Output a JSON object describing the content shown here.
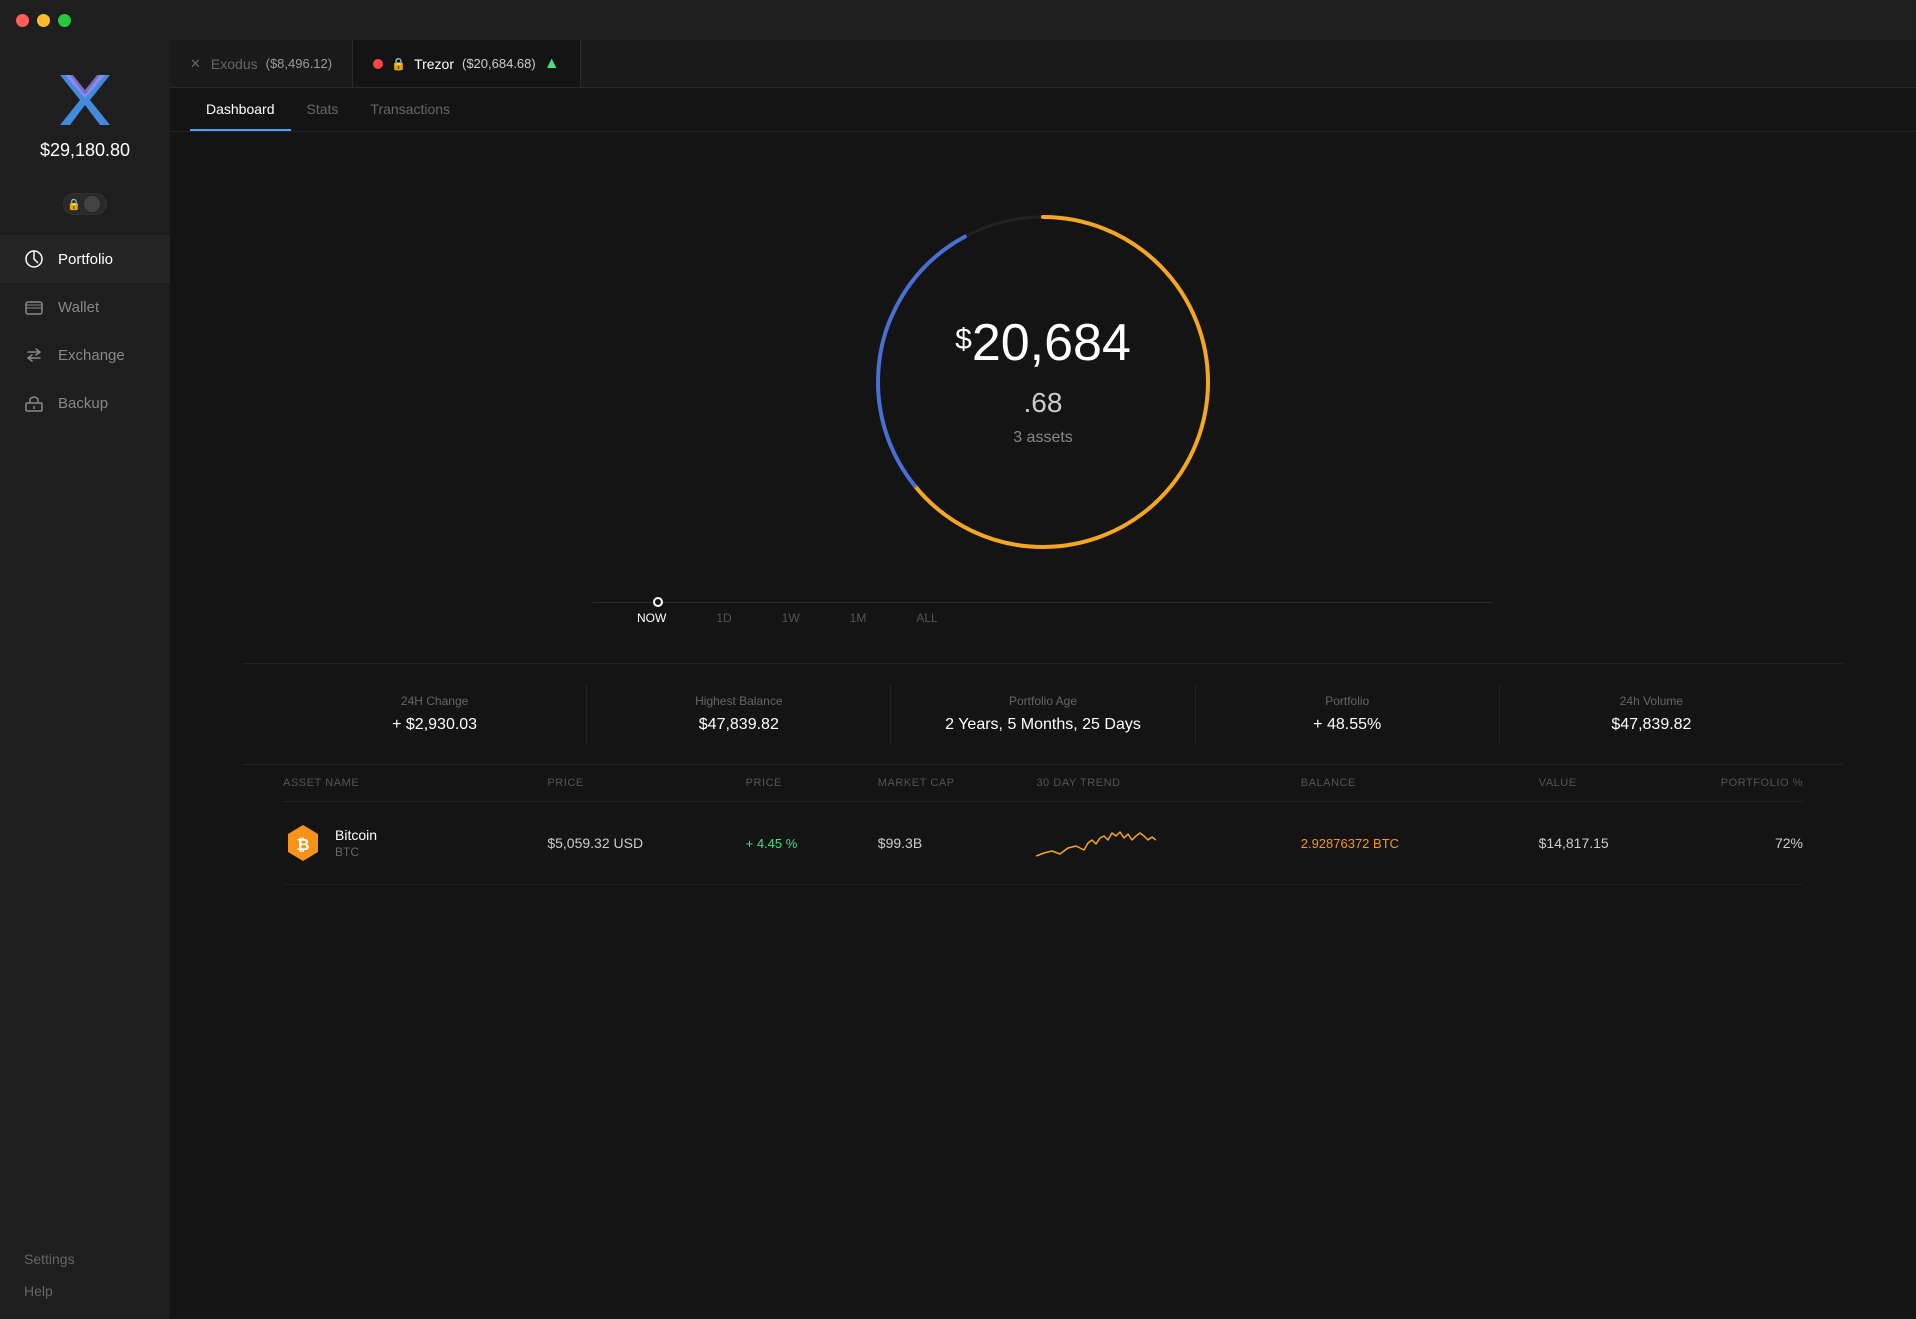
{
  "titlebar": {
    "dots": [
      "red",
      "yellow",
      "green"
    ]
  },
  "sidebar": {
    "balance": "$29,180.80",
    "nav_items": [
      {
        "id": "portfolio",
        "label": "Portfolio",
        "active": true
      },
      {
        "id": "wallet",
        "label": "Wallet",
        "active": false
      },
      {
        "id": "exchange",
        "label": "Exchange",
        "active": false
      },
      {
        "id": "backup",
        "label": "Backup",
        "active": false
      }
    ],
    "bottom_items": [
      {
        "id": "settings",
        "label": "Settings"
      },
      {
        "id": "help",
        "label": "Help"
      }
    ]
  },
  "wallet_tabs": [
    {
      "id": "exodus",
      "name": "Exodus",
      "amount": "($8,496.12)",
      "active": false,
      "has_dot": false
    },
    {
      "id": "trezor",
      "name": "Trezor",
      "amount": "($20,684.68)",
      "active": true,
      "has_dot": true
    }
  ],
  "page_tabs": [
    {
      "id": "dashboard",
      "label": "Dashboard",
      "active": true
    },
    {
      "id": "stats",
      "label": "Stats",
      "active": false
    },
    {
      "id": "transactions",
      "label": "Transactions",
      "active": false
    }
  ],
  "portfolio": {
    "total_amount": "20,684",
    "total_cents": ".68",
    "assets_count": "3 assets",
    "timeline": [
      {
        "id": "now",
        "label": "NOW",
        "active": true
      },
      {
        "id": "1d",
        "label": "1D",
        "active": false
      },
      {
        "id": "1w",
        "label": "1W",
        "active": false
      },
      {
        "id": "1m",
        "label": "1M",
        "active": false
      },
      {
        "id": "all",
        "label": "ALL",
        "active": false
      }
    ]
  },
  "stats": {
    "change_24h_label": "24H Change",
    "change_24h_value": "+ $2,930.03",
    "highest_balance_label": "Highest Balance",
    "highest_balance_value": "$47,839.82",
    "portfolio_age_label": "Portfolio Age",
    "portfolio_age_value": "2 Years, 5 Months, 25 Days",
    "portfolio_label": "Portfolio",
    "portfolio_value": "+ 48.55%",
    "volume_24h_label": "24h Volume",
    "volume_24h_value": "$47,839.82"
  },
  "asset_table": {
    "headers": {
      "name": "ASSET NAME",
      "price": "PRICE",
      "price_change": "PRICE",
      "market_cap": "MARKET CAP",
      "trend": "30 DAY TREND",
      "balance": "BALANCE",
      "value": "VALUE",
      "portfolio": "PORTFOLIO %"
    },
    "rows": [
      {
        "id": "btc",
        "name": "Bitcoin",
        "ticker": "BTC",
        "price": "$5,059.32 USD",
        "price_change": "+ 4.45 %",
        "market_cap": "$99.3B",
        "balance": "2.92876372 BTC",
        "value": "$14,817.15",
        "portfolio": "72%",
        "icon": "₿",
        "icon_color": "#f7931a"
      }
    ]
  },
  "donut": {
    "blue_segment_pct": 28,
    "yellow_segment_pct": 72
  }
}
